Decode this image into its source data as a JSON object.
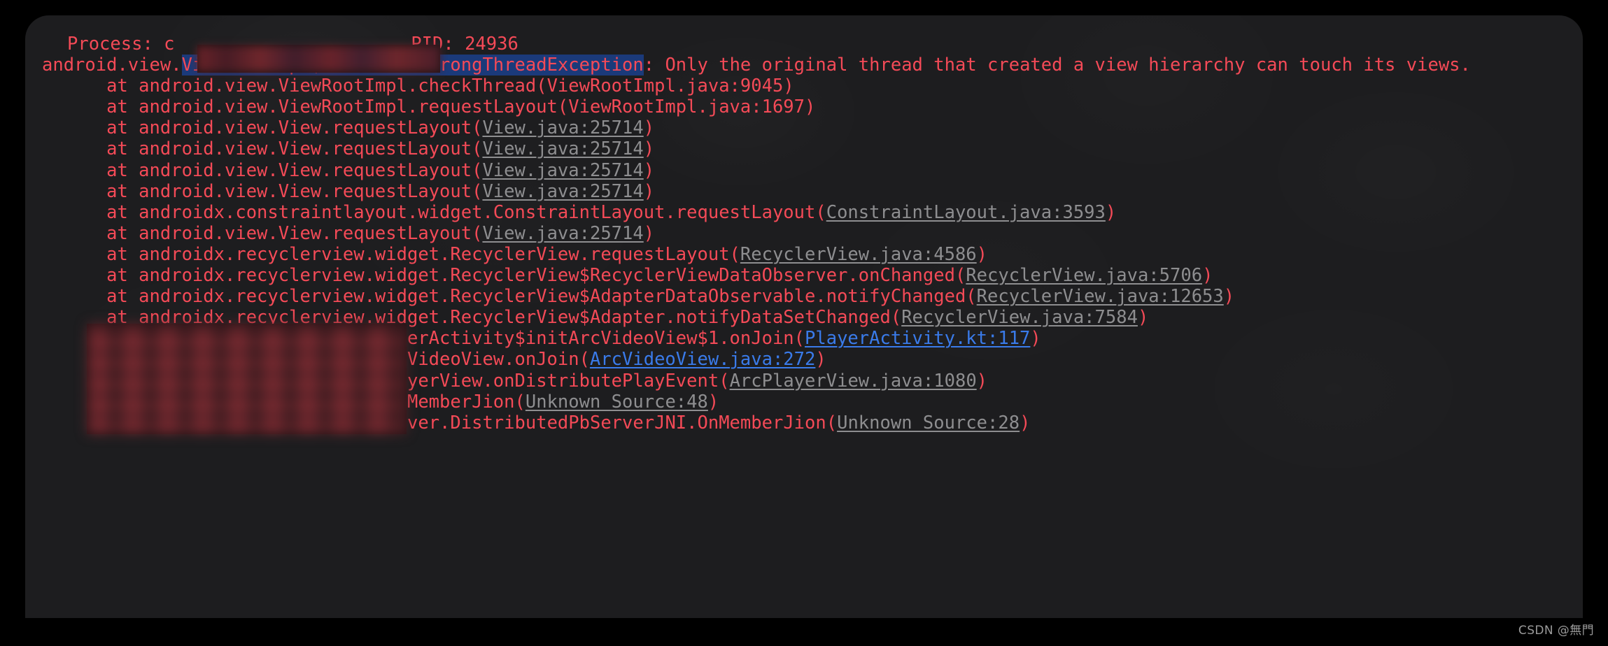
{
  "window": {
    "background_color": "#000000",
    "panel_color": "#1d1d1f",
    "corner_radius_px": 34
  },
  "theme": {
    "text_color": "#f44a57",
    "selection_background": "#1b3a7a",
    "dim_link_color": "#8e8e90",
    "blue_link_color": "#3a7bea",
    "watermark_color": "#9a9a9a"
  },
  "header": {
    "process_label": "Process: ",
    "process_value_visible": "c",
    "process_value_redacted": true,
    "pid_label": "PID: ",
    "pid_value": "24936"
  },
  "exception": {
    "package_prefix": "android.view.",
    "selected_class": "ViewRootImpl$CalledFromWrongThreadException",
    "separator": ": ",
    "message": "Only the original thread that created a view hierarchy can touch its views."
  },
  "stack_frames": [
    {
      "at": "at ",
      "call": "android.view.ViewRootImpl.checkThread(",
      "ref": "ViewRootImpl.java:9045",
      "ref_style": "plain",
      "close": ")",
      "redacted_prefix": false
    },
    {
      "at": "at ",
      "call": "android.view.ViewRootImpl.requestLayout(",
      "ref": "ViewRootImpl.java:1697",
      "ref_style": "plain",
      "close": ")",
      "redacted_prefix": false
    },
    {
      "at": "at ",
      "call": "android.view.View.requestLayout(",
      "ref": "View.java:25714",
      "ref_style": "dim",
      "close": ")",
      "redacted_prefix": false
    },
    {
      "at": "at ",
      "call": "android.view.View.requestLayout(",
      "ref": "View.java:25714",
      "ref_style": "dim",
      "close": ")",
      "redacted_prefix": false
    },
    {
      "at": "at ",
      "call": "android.view.View.requestLayout(",
      "ref": "View.java:25714",
      "ref_style": "dim",
      "close": ")",
      "redacted_prefix": false
    },
    {
      "at": "at ",
      "call": "android.view.View.requestLayout(",
      "ref": "View.java:25714",
      "ref_style": "dim",
      "close": ")",
      "redacted_prefix": false
    },
    {
      "at": "at ",
      "call": "androidx.constraintlayout.widget.ConstraintLayout.requestLayout(",
      "ref": "ConstraintLayout.java:3593",
      "ref_style": "dim",
      "close": ")",
      "redacted_prefix": false
    },
    {
      "at": "at ",
      "call": "android.view.View.requestLayout(",
      "ref": "View.java:25714",
      "ref_style": "dim",
      "close": ")",
      "redacted_prefix": false
    },
    {
      "at": "at ",
      "call": "androidx.recyclerview.widget.RecyclerView.requestLayout(",
      "ref": "RecyclerView.java:4586",
      "ref_style": "dim",
      "close": ")",
      "redacted_prefix": false
    },
    {
      "at": "at ",
      "call": "androidx.recyclerview.widget.RecyclerView$RecyclerViewDataObserver.onChanged(",
      "ref": "RecyclerView.java:5706",
      "ref_style": "dim",
      "close": ")",
      "redacted_prefix": false
    },
    {
      "at": "at ",
      "call": "androidx.recyclerview.widget.RecyclerView$AdapterDataObservable.notifyChanged(",
      "ref": "RecyclerView.java:12653",
      "ref_style": "dim",
      "close": ")",
      "redacted_prefix": false
    },
    {
      "at": "at ",
      "call": "androidx.recyclerview.widget.RecyclerView$Adapter.notifyDataSetChanged(",
      "ref": "RecyclerView.java:7584",
      "ref_style": "dim",
      "close": ")",
      "redacted_prefix": false
    },
    {
      "at": "",
      "call": "layerActivity$initArcVideoView$1.onJoin(",
      "ref": "PlayerActivity.kt:117",
      "ref_style": "blue",
      "close": ")",
      "redacted_prefix": true
    },
    {
      "at": "",
      "call": "ArcVideoView.onJoin(",
      "ref": "ArcVideoView.java:272",
      "ref_style": "blue",
      "close": ")",
      "redacted_prefix": true
    },
    {
      "at": "",
      "call": "PlayerView.onDistributePlayEvent(",
      "ref": "ArcPlayerView.java:1080",
      "ref_style": "dim",
      "close": ")",
      "redacted_prefix": true
    },
    {
      "at": "",
      "call": ".onMemberJion(",
      "ref": "Unknown Source:48",
      "ref_style": "dim",
      "close": ")",
      "redacted_prefix": true
    },
    {
      "at": "",
      "call": "lpbserver.DistributedPbServerJNI.OnMemberJion(",
      "ref": "Unknown Source:28",
      "ref_style": "dim",
      "close": ")",
      "redacted_prefix": true
    }
  ],
  "watermark": {
    "text": "CSDN @無門"
  }
}
